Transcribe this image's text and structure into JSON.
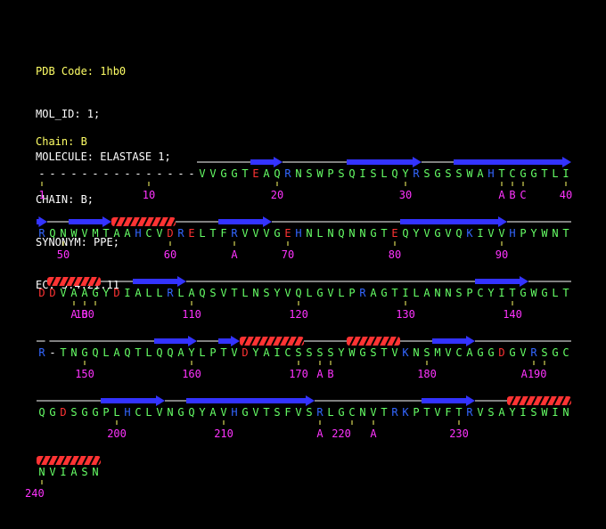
{
  "header": {
    "pdb_code": "PDB Code: 1hb0",
    "lines": [
      "MOL_ID: 1;",
      "MOLECULE: ELASTASE 1;",
      "CHAIN: B;",
      "SYNONYM: PPE;",
      "EC: 3.4.21.11"
    ]
  },
  "chain_title": "Chain: B",
  "colors": {
    "hydrophobic": "#66ff66",
    "polar": "#66ff66",
    "acidic": "#ff3333",
    "basic": "#3366ff",
    "unobserved": "#ffffff",
    "number": "#ff33ff",
    "strand": "#3333ff",
    "helix": "#ff3333",
    "coil": "#ffffff"
  },
  "lines": [
    {
      "seq": "---------------VVGGTEAQRNSWPSQISLQYRSGSSWAHTCGGTLI",
      "labels": [
        {
          "i": 0,
          "t": "1"
        },
        {
          "i": 10,
          "t": "10"
        },
        {
          "i": 22,
          "t": "20"
        },
        {
          "i": 34,
          "t": "30"
        },
        {
          "i": 43,
          "t": "A"
        },
        {
          "i": 44,
          "t": "B"
        },
        {
          "i": 45,
          "t": "C"
        },
        {
          "i": 49,
          "t": "40"
        }
      ],
      "ticks": [
        0,
        10,
        22,
        34,
        43,
        44,
        45,
        49
      ],
      "ss": [
        {
          "type": "coil",
          "start": 15,
          "end": 20
        },
        {
          "type": "strand",
          "start": 20,
          "end": 23
        },
        {
          "type": "coil",
          "start": 23,
          "end": 29
        },
        {
          "type": "strand",
          "start": 29,
          "end": 36
        },
        {
          "type": "coil",
          "start": 36,
          "end": 39
        },
        {
          "type": "strand",
          "start": 39,
          "end": 50
        }
      ]
    },
    {
      "seq": "RQNWVMTAAHCVDRELTFRVVVGEHNLNQNNGTEQYVGVQKIVVHPYWNT",
      "labels": [
        {
          "i": 2,
          "t": "50"
        },
        {
          "i": 12,
          "t": "60"
        },
        {
          "i": 18,
          "t": "A"
        },
        {
          "i": 23,
          "t": "70"
        },
        {
          "i": 33,
          "t": "80"
        },
        {
          "i": 43,
          "t": "90"
        }
      ],
      "ticks": [
        2,
        12,
        18,
        23,
        33,
        43
      ],
      "ss": [
        {
          "type": "strand",
          "start": 0,
          "end": 1
        },
        {
          "type": "coil",
          "start": 1,
          "end": 3
        },
        {
          "type": "strand",
          "start": 3,
          "end": 7
        },
        {
          "type": "coil",
          "start": 7,
          "end": 7
        },
        {
          "type": "helix",
          "start": 7,
          "end": 13
        },
        {
          "type": "coil",
          "start": 13,
          "end": 17
        },
        {
          "type": "strand",
          "start": 17,
          "end": 22
        },
        {
          "type": "coil",
          "start": 22,
          "end": 34
        },
        {
          "type": "strand",
          "start": 34,
          "end": 44
        },
        {
          "type": "coil",
          "start": 44,
          "end": 50
        }
      ]
    },
    {
      "seq": "DDVAAGYDIALLRLAQSVTLNSYVQLGVLPRAGTILANNSPCYITGWGLT",
      "labels": [
        {
          "i": 3,
          "t": "A"
        },
        {
          "i": 4,
          "t": "B"
        },
        {
          "i": 4,
          "t": "100"
        },
        {
          "i": 14,
          "t": "110"
        },
        {
          "i": 24,
          "t": "120"
        },
        {
          "i": 34,
          "t": "130"
        },
        {
          "i": 44,
          "t": "140"
        }
      ],
      "ticks": [
        3,
        4,
        5,
        14,
        24,
        34,
        44
      ],
      "ss": [
        {
          "type": "helix",
          "start": 1,
          "end": 6
        },
        {
          "type": "coil",
          "start": 6,
          "end": 9
        },
        {
          "type": "strand",
          "start": 9,
          "end": 14
        },
        {
          "type": "coil",
          "start": 14,
          "end": 41
        },
        {
          "type": "strand",
          "start": 41,
          "end": 46
        },
        {
          "type": "coil",
          "start": 46,
          "end": 50
        }
      ]
    },
    {
      "seq": "R-TNGQLAQTLQQAYLPTVDYAICSSSSYWGSTVKNSMVCAGGDGVRSGC",
      "labels": [
        {
          "i": 4,
          "t": "150"
        },
        {
          "i": 14,
          "t": "160"
        },
        {
          "i": 24,
          "t": "170"
        },
        {
          "i": 26,
          "t": "A"
        },
        {
          "i": 27,
          "t": "B"
        },
        {
          "i": 36,
          "t": "180"
        },
        {
          "i": 46,
          "t": "A190"
        }
      ],
      "ticks": [
        4,
        14,
        24,
        26,
        27,
        36,
        46,
        47
      ],
      "ss": [
        {
          "type": "coil",
          "start": 0,
          "end": 0.8
        },
        {
          "type": "coil",
          "start": 1.2,
          "end": 11
        },
        {
          "type": "strand",
          "start": 11,
          "end": 15
        },
        {
          "type": "coil",
          "start": 15,
          "end": 17
        },
        {
          "type": "strand",
          "start": 17,
          "end": 19
        },
        {
          "type": "helix",
          "start": 19,
          "end": 25
        },
        {
          "type": "coil",
          "start": 25,
          "end": 29
        },
        {
          "type": "helix",
          "start": 29,
          "end": 34
        },
        {
          "type": "coil",
          "start": 34,
          "end": 37
        },
        {
          "type": "strand",
          "start": 37,
          "end": 41
        },
        {
          "type": "coil",
          "start": 41,
          "end": 50
        }
      ]
    },
    {
      "seq": "QGDSGGPLHCLVNGQYAVHGVTSFVSRLGCNVTRKPTVFTRVSAYISWIN",
      "labels": [
        {
          "i": 7,
          "t": "200"
        },
        {
          "i": 17,
          "t": "210"
        },
        {
          "i": 26,
          "t": "A"
        },
        {
          "i": 28,
          "t": "220"
        },
        {
          "i": 31,
          "t": "A"
        },
        {
          "i": 39,
          "t": "230"
        }
      ],
      "ticks": [
        7,
        17,
        26,
        29,
        31,
        39
      ],
      "ss": [
        {
          "type": "coil",
          "start": 0,
          "end": 6
        },
        {
          "type": "strand",
          "start": 6,
          "end": 12
        },
        {
          "type": "coil",
          "start": 12,
          "end": 14
        },
        {
          "type": "strand",
          "start": 14,
          "end": 26
        },
        {
          "type": "coil",
          "start": 26,
          "end": 36
        },
        {
          "type": "strand",
          "start": 36,
          "end": 41
        },
        {
          "type": "coil",
          "start": 41,
          "end": 44
        },
        {
          "type": "helix",
          "start": 44,
          "end": 50
        }
      ]
    },
    {
      "seq": "NVIASN",
      "labels": [
        {
          "i": -1,
          "t": "240"
        }
      ],
      "ticks": [
        0
      ],
      "ss": [
        {
          "type": "helix",
          "start": 0,
          "end": 6
        }
      ]
    }
  ]
}
